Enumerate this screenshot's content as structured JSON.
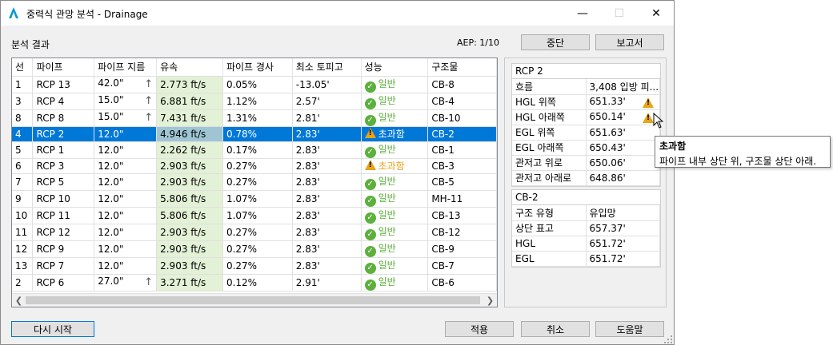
{
  "window": {
    "title": "중력식 관망 분석 - Drainage"
  },
  "header": {
    "section_label": "분석 결과",
    "aep": "AEP: 1/10",
    "stop_label": "중단",
    "report_label": "보고서"
  },
  "grid": {
    "columns": [
      "선",
      "파이프",
      "파이프 지름",
      "유속",
      "파이프 경사",
      "최소 토피고",
      "성능",
      "구조물"
    ],
    "rows": [
      {
        "id": "1",
        "pipe": "RCP 13",
        "dia": "42.0\"",
        "arrow": true,
        "vel": "2.773 ft/s",
        "slope": "0.05%",
        "cover": "-13.05'",
        "perf": "일반",
        "status": "ok",
        "struct": "CB-8"
      },
      {
        "id": "3",
        "pipe": "RCP 4",
        "dia": "15.0\"",
        "arrow": true,
        "vel": "6.881 ft/s",
        "slope": "1.12%",
        "cover": "2.57'",
        "perf": "일반",
        "status": "ok",
        "struct": "CB-4"
      },
      {
        "id": "8",
        "pipe": "RCP 8",
        "dia": "15.0\"",
        "arrow": true,
        "vel": "7.431 ft/s",
        "slope": "1.31%",
        "cover": "2.81'",
        "perf": "일반",
        "status": "ok",
        "struct": "CB-10"
      },
      {
        "id": "4",
        "pipe": "RCP 2",
        "dia": "12.0\"",
        "arrow": false,
        "vel": "4.946 ft/s",
        "slope": "0.78%",
        "cover": "2.83'",
        "perf": "초과함",
        "status": "warn",
        "struct": "CB-2",
        "selected": true
      },
      {
        "id": "5",
        "pipe": "RCP 1",
        "dia": "12.0\"",
        "arrow": false,
        "vel": "2.262 ft/s",
        "slope": "0.17%",
        "cover": "2.83'",
        "perf": "일반",
        "status": "ok",
        "struct": "CB-1"
      },
      {
        "id": "6",
        "pipe": "RCP 3",
        "dia": "12.0\"",
        "arrow": false,
        "vel": "2.903 ft/s",
        "slope": "0.27%",
        "cover": "2.83'",
        "perf": "초과함",
        "status": "warn",
        "struct": "CB-3"
      },
      {
        "id": "7",
        "pipe": "RCP 5",
        "dia": "12.0\"",
        "arrow": false,
        "vel": "2.903 ft/s",
        "slope": "0.27%",
        "cover": "2.83'",
        "perf": "일반",
        "status": "ok",
        "struct": "CB-5"
      },
      {
        "id": "9",
        "pipe": "RCP 10",
        "dia": "12.0\"",
        "arrow": false,
        "vel": "5.806 ft/s",
        "slope": "1.07%",
        "cover": "2.83'",
        "perf": "일반",
        "status": "ok",
        "struct": "MH-11"
      },
      {
        "id": "10",
        "pipe": "RCP 11",
        "dia": "12.0\"",
        "arrow": false,
        "vel": "5.806 ft/s",
        "slope": "1.07%",
        "cover": "2.83'",
        "perf": "일반",
        "status": "ok",
        "struct": "CB-13"
      },
      {
        "id": "11",
        "pipe": "RCP 12",
        "dia": "12.0\"",
        "arrow": false,
        "vel": "2.903 ft/s",
        "slope": "0.27%",
        "cover": "2.83'",
        "perf": "일반",
        "status": "ok",
        "struct": "CB-12"
      },
      {
        "id": "12",
        "pipe": "RCP 9",
        "dia": "12.0\"",
        "arrow": false,
        "vel": "2.903 ft/s",
        "slope": "0.27%",
        "cover": "2.83'",
        "perf": "일반",
        "status": "ok",
        "struct": "CB-9"
      },
      {
        "id": "13",
        "pipe": "RCP 7",
        "dia": "12.0\"",
        "arrow": false,
        "vel": "2.903 ft/s",
        "slope": "0.27%",
        "cover": "2.83'",
        "perf": "일반",
        "status": "ok",
        "struct": "CB-7"
      },
      {
        "id": "2",
        "pipe": "RCP 6",
        "dia": "27.0\"",
        "arrow": true,
        "vel": "3.271 ft/s",
        "slope": "0.12%",
        "cover": "2.91'",
        "perf": "일반",
        "status": "ok",
        "struct": "CB-6"
      }
    ]
  },
  "pipe_props": {
    "title": "RCP 2",
    "rows": [
      {
        "k": "흐름",
        "v": "3,408 입방 피...",
        "warn": false
      },
      {
        "k": "HGL 위쪽",
        "v": "651.33'",
        "warn": true
      },
      {
        "k": "HGL 아래쪽",
        "v": "650.14'",
        "warn": true
      },
      {
        "k": "EGL 위쪽",
        "v": "651.63'",
        "warn": false
      },
      {
        "k": "EGL 아래쪽",
        "v": "650.43'",
        "warn": false
      },
      {
        "k": "관저고 위로",
        "v": "650.06'",
        "warn": false
      },
      {
        "k": "관저고 아래로",
        "v": "648.86'",
        "warn": false
      }
    ]
  },
  "struct_props": {
    "title": "CB-2",
    "rows": [
      {
        "k": "구조 유형",
        "v": "유입망"
      },
      {
        "k": "상단 표고",
        "v": "657.37'"
      },
      {
        "k": "HGL",
        "v": "651.72'"
      },
      {
        "k": "EGL",
        "v": "651.72'"
      }
    ]
  },
  "tooltip": {
    "title": "초과함",
    "text": "파이프 내부 상단 위, 구조물 상단 아래."
  },
  "footer": {
    "restart_label": "다시 시작",
    "apply_label": "적용",
    "cancel_label": "취소",
    "help_label": "도움말"
  },
  "colors": {
    "ok": "#5cb03c",
    "warn": "#e8a317",
    "selection": "#0078d7",
    "velocity_bg": "#e3f1d6"
  }
}
